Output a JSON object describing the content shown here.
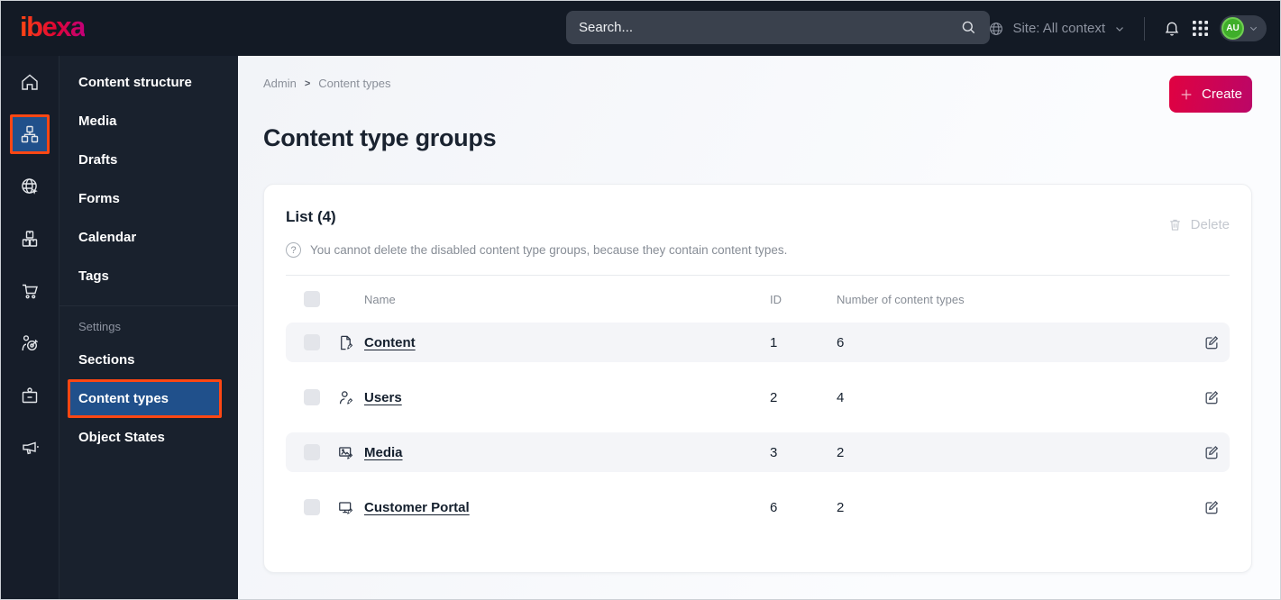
{
  "topbar": {
    "logo_text": "ibexa",
    "search_placeholder": "Search...",
    "site_selector": "Site: All context",
    "avatar_initials": "AU"
  },
  "sidebar": {
    "rail_icons": [
      "home",
      "content-structure",
      "site",
      "product-catalog",
      "commerce",
      "personalization",
      "admin",
      "marketing"
    ],
    "active_rail_icon": "content-structure",
    "menu_items": [
      "Content structure",
      "Media",
      "Drafts",
      "Forms",
      "Calendar",
      "Tags"
    ],
    "settings_heading": "Settings",
    "settings_items": [
      "Sections",
      "Content types",
      "Object States"
    ],
    "active_menu_item": "Content types"
  },
  "main": {
    "breadcrumb": {
      "items": [
        "Admin",
        "Content types"
      ],
      "separator": ">"
    },
    "create_button": "Create",
    "page_title": "Content type groups",
    "list_panel": {
      "title": "List (4)",
      "help_text": "You cannot delete the disabled content type groups, because they contain content types.",
      "delete_button": "Delete",
      "table": {
        "columns": [
          "Name",
          "ID",
          "Number of content types"
        ],
        "rows": [
          {
            "icon": "file-edit",
            "name": "Content",
            "id": "1",
            "content_types": "6"
          },
          {
            "icon": "user-edit",
            "name": "Users",
            "id": "2",
            "content_types": "4"
          },
          {
            "icon": "image-edit",
            "name": "Media",
            "id": "3",
            "content_types": "2"
          },
          {
            "icon": "monitor-edit",
            "name": "Customer Portal",
            "id": "6",
            "content_types": "2"
          }
        ]
      }
    }
  },
  "colors": {
    "topbar_bg": "#131a25",
    "rail_bg": "#161d29",
    "menu_bg": "#19212d",
    "accent_orange": "#ff4713",
    "selected_blue": "#20508b",
    "create_start": "#e00241",
    "create_end": "#bb0667",
    "avatar_green": "#3fae2a",
    "text_dark": "#15202e",
    "text_gray": "#878d96"
  }
}
